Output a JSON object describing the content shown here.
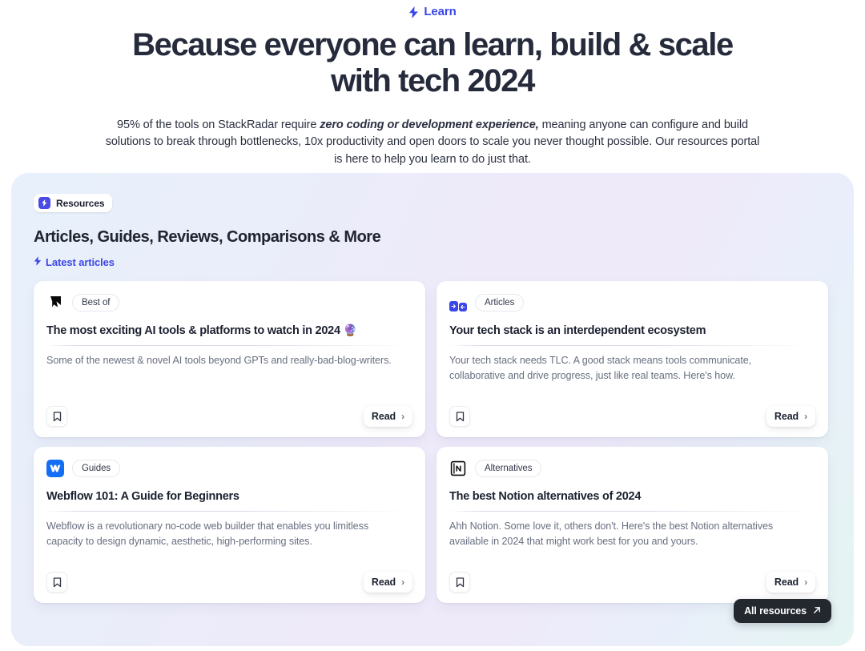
{
  "hero": {
    "eyebrow": "Learn",
    "eyebrow_icon": "lightning-bolt-icon",
    "title": "Because everyone can learn, build & scale with tech 2024",
    "subtitle_part1": "95% of the tools on StackRadar require ",
    "subtitle_emphasis": "zero coding or development experience,",
    "subtitle_part2": " meaning anyone can configure and build solutions to break through bottlenecks, 10x productivity and open doors to scale you never thought possible. Our resources portal is here to help you learn to do just that."
  },
  "panel": {
    "chip_label": "Resources",
    "chip_icon": "lightning-bolt-icon",
    "title": "Articles, Guides, Reviews, Comparisons & More",
    "sublink": "Latest articles",
    "sublink_icon": "lightning-bolt-icon",
    "all_resources_label": "All resources",
    "all_resources_icon": "arrow-up-right-icon",
    "accent_blue": "#3B46E8",
    "badge_blue": "#4A4AE6",
    "dark_button": "#23272E"
  },
  "cards": [
    {
      "logo": "framer-cursor-icon",
      "tag": "Best of",
      "title": "The most exciting AI tools & platforms to watch in 2024 ",
      "title_emoji": "🔮",
      "desc": "Some of the newest & novel AI tools beyond GPTs and really-bad-blog-writers.",
      "read_label": "Read",
      "read_chevron": "›",
      "bookmark_icon": "bookmark-icon"
    },
    {
      "logo": "articles-squares-icon",
      "tag": "Articles",
      "title": "Your tech stack is an interdependent ecosystem",
      "title_emoji": "",
      "desc": "Your tech stack needs TLC. A good stack means tools communicate, collaborative and drive progress, just like real teams. Here's how.",
      "read_label": "Read",
      "read_chevron": "›",
      "bookmark_icon": "bookmark-icon"
    },
    {
      "logo": "webflow-icon",
      "tag": "Guides",
      "title": "Webflow 101: A Guide for Beginners",
      "title_emoji": "",
      "desc": "Webflow is a revolutionary no-code web builder that enables you limitless capacity to design dynamic, aesthetic, high-performing sites.",
      "read_label": "Read",
      "read_chevron": "›",
      "bookmark_icon": "bookmark-icon"
    },
    {
      "logo": "notion-icon",
      "tag": "Alternatives",
      "title": "The best Notion alternatives of 2024",
      "title_emoji": "",
      "desc": "Ahh Notion. Some love it, others don't. Here's the best Notion alternatives available in 2024 that might work best for you and yours.",
      "read_label": "Read",
      "read_chevron": "›",
      "bookmark_icon": "bookmark-icon"
    }
  ]
}
